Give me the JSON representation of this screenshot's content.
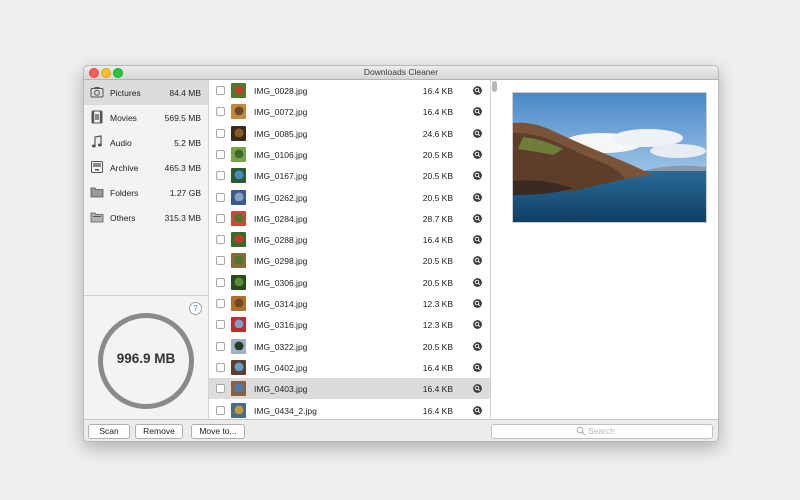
{
  "window": {
    "title": "Downloads Cleaner"
  },
  "sidebar": {
    "categories": [
      {
        "label": "Pictures",
        "size": "84.4 MB",
        "icon": "camera-icon",
        "selected": true
      },
      {
        "label": "Movies",
        "size": "569.5 MB",
        "icon": "film-icon",
        "selected": false
      },
      {
        "label": "Audio",
        "size": "5.2 MB",
        "icon": "music-note-icon",
        "selected": false
      },
      {
        "label": "Archive",
        "size": "465.3 MB",
        "icon": "archive-icon",
        "selected": false
      },
      {
        "label": "Folders",
        "size": "1.27 GB",
        "icon": "folder-icon",
        "selected": false
      },
      {
        "label": "Others",
        "size": "315.3 MB",
        "icon": "files-icon",
        "selected": false
      }
    ],
    "help_label": "?",
    "total_label": "996.9 MB"
  },
  "files": [
    {
      "name": "IMG_0028.jpg",
      "size": "16.4 KB"
    },
    {
      "name": "IMG_0072.jpg",
      "size": "16.4 KB"
    },
    {
      "name": "IMG_0085.jpg",
      "size": "24.6 KB"
    },
    {
      "name": "IMG_0106.jpg",
      "size": "20.5 KB"
    },
    {
      "name": "IMG_0167.jpg",
      "size": "20.5 KB"
    },
    {
      "name": "IMG_0262.jpg",
      "size": "20.5 KB"
    },
    {
      "name": "IMG_0284.jpg",
      "size": "28.7 KB"
    },
    {
      "name": "IMG_0288.jpg",
      "size": "16.4 KB"
    },
    {
      "name": "IMG_0298.jpg",
      "size": "20.5 KB"
    },
    {
      "name": "IMG_0306.jpg",
      "size": "20.5 KB"
    },
    {
      "name": "IMG_0314.jpg",
      "size": "12.3 KB"
    },
    {
      "name": "IMG_0316.jpg",
      "size": "12.3 KB"
    },
    {
      "name": "IMG_0322.jpg",
      "size": "20.5 KB"
    },
    {
      "name": "IMG_0402.jpg",
      "size": "16.4 KB"
    },
    {
      "name": "IMG_0403.jpg",
      "size": "16.4 KB"
    },
    {
      "name": "IMG_0434_2.jpg",
      "size": "16.4 KB"
    }
  ],
  "selected_file_index": 14,
  "toolbar": {
    "scan_label": "Scan",
    "remove_label": "Remove",
    "move_label": "Move to..."
  },
  "search": {
    "placeholder": "Search"
  },
  "colors": {
    "selection": "#dcdcdc",
    "gauge": "#8a8a8a",
    "close": "#fc5f57",
    "minimize": "#fdbc2e",
    "zoom": "#28c840"
  }
}
